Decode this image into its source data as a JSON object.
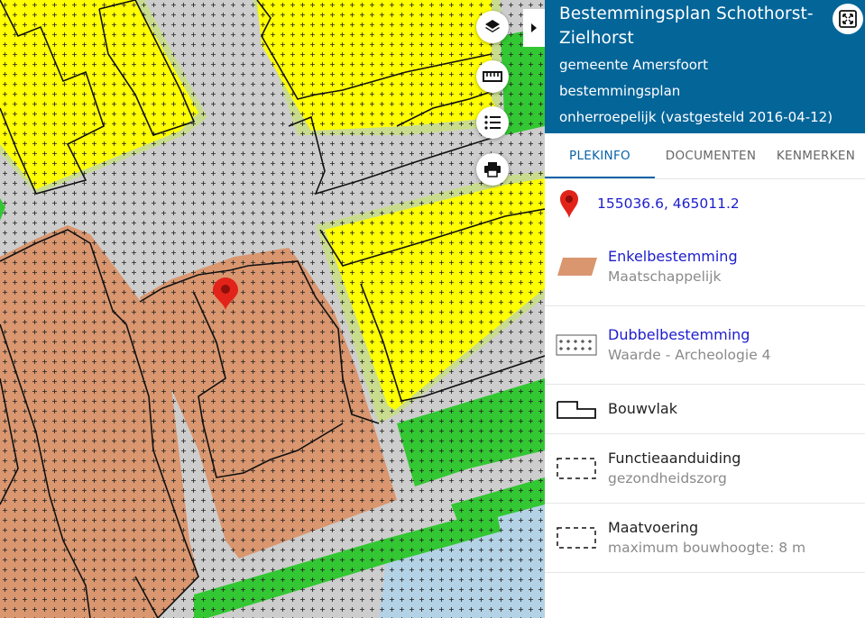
{
  "panel": {
    "title": "Bestemmingsplan Schothorst-Zielhorst",
    "municipality": "gemeente Amersfoort",
    "plan_type": "bestemmingsplan",
    "status": "onherroepelijk (vastgesteld 2016-04-12)",
    "header_color": "#046599"
  },
  "tabs": [
    {
      "label": "PLEKINFO",
      "active": true
    },
    {
      "label": "DOCUMENTEN",
      "active": false
    },
    {
      "label": "KENMERKEN",
      "active": false
    }
  ],
  "location": {
    "coordinates": "155036.6, 465011.2",
    "icon": "map-marker-icon"
  },
  "legend": [
    {
      "title": "Enkelbestemming",
      "subtitle": "Maatschappelijk",
      "symbol": "brown-parallelogram",
      "link": true
    },
    {
      "title": "Dubbelbestemming",
      "subtitle": "Waarde - Archeologie 4",
      "symbol": "crosshatch-box",
      "link": true
    },
    {
      "title": "Bouwvlak",
      "subtitle": "",
      "symbol": "building-outline",
      "link": false
    },
    {
      "title": "Functieaanduiding",
      "subtitle": "gezondheidszorg",
      "symbol": "dashed-box",
      "link": false
    },
    {
      "title": "Maatvoering",
      "subtitle": "maximum bouwhoogte: 8 m",
      "symbol": "dashed-box",
      "link": false
    }
  ],
  "map_controls": [
    "layers-icon",
    "ruler-icon",
    "list-icon",
    "print-icon"
  ],
  "map_colors": {
    "maatschappelijk": "#d9966f",
    "wonen": "#ffff00",
    "groen": "#33c733",
    "water": "#b4d2e5",
    "verkeer": "#cdcdcd",
    "tuin": "#c9dc8e"
  }
}
